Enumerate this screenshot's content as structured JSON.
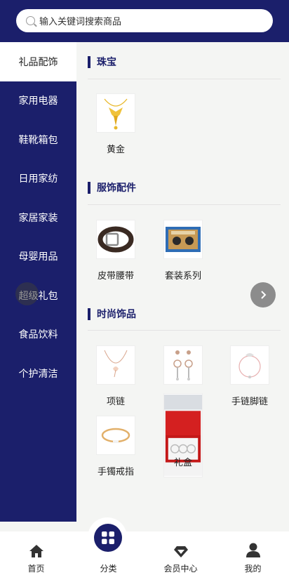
{
  "search": {
    "placeholder": "输入关键词搜索商品"
  },
  "sidebar": {
    "items": [
      {
        "label": "礼品配饰",
        "active": true
      },
      {
        "label": "家用电器"
      },
      {
        "label": "鞋靴箱包"
      },
      {
        "label": "日用家纺"
      },
      {
        "label": "家居家装"
      },
      {
        "label": "母婴用品"
      },
      {
        "label": "超级礼包"
      },
      {
        "label": "食品饮料"
      },
      {
        "label": "个护清洁"
      }
    ]
  },
  "sections": [
    {
      "title": "珠宝",
      "items": [
        {
          "label": "黄金",
          "icon": "gold-necklace-icon"
        }
      ]
    },
    {
      "title": "服饰配件",
      "items": [
        {
          "label": "皮带腰带",
          "icon": "belt-icon"
        },
        {
          "label": "套装系列",
          "icon": "gift-set-icon"
        }
      ]
    },
    {
      "title": "时尚饰品",
      "items": [
        {
          "label": "项链",
          "icon": "necklace-icon"
        },
        {
          "label": "",
          "icon": "earrings-icon"
        },
        {
          "label": "手链脚链",
          "icon": "bracelet-icon"
        },
        {
          "label": "手镯戒指",
          "icon": "bangle-icon"
        },
        {
          "label": "礼盒",
          "icon": "gift-box-icon"
        }
      ]
    }
  ],
  "tabbar": {
    "tabs": [
      {
        "label": "首页",
        "icon": "home-icon"
      },
      {
        "label": "分类",
        "icon": "category-icon",
        "active": true
      },
      {
        "label": "会员中心",
        "icon": "diamond-icon"
      },
      {
        "label": "我的",
        "icon": "user-icon"
      }
    ]
  },
  "colors": {
    "primary": "#1b1f6b",
    "background": "#f4f5f3",
    "gold": "#e8b82a"
  }
}
